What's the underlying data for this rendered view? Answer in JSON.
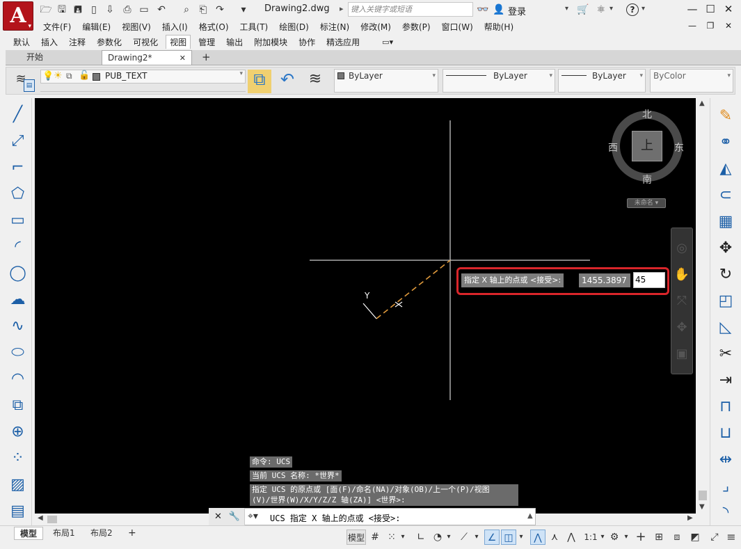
{
  "app": {
    "logo_letter": "A",
    "document_title": "Drawing2.dwg",
    "search_placeholder": "键入关键字或短语",
    "login_label": "登录",
    "help_icon": "?"
  },
  "window_controls": {
    "minimize": "—",
    "maximize": "☐",
    "close": "✕"
  },
  "mdi_controls": {
    "minimize": "—",
    "restore": "❐",
    "close": "✕"
  },
  "menu": [
    "文件(F)",
    "编辑(E)",
    "视图(V)",
    "插入(I)",
    "格式(O)",
    "工具(T)",
    "绘图(D)",
    "标注(N)",
    "修改(M)",
    "参数(P)",
    "窗口(W)",
    "帮助(H)"
  ],
  "ribbon_tabs": {
    "items": [
      "默认",
      "插入",
      "注释",
      "参数化",
      "可视化",
      "视图",
      "管理",
      "输出",
      "附加模块",
      "协作",
      "精选应用"
    ],
    "active": "视图"
  },
  "file_tabs": {
    "start_label": "开始",
    "active_label": "Drawing2*",
    "close_icon": "✕",
    "add_icon": "+"
  },
  "properties_toolbar": {
    "layer_name": "PUB_TEXT",
    "color_combo": "ByLayer",
    "linetype_combo": "ByLayer",
    "lineweight_combo": "ByLayer",
    "plotstyle_combo": "ByColor"
  },
  "viewcube": {
    "north": "北",
    "south": "南",
    "west": "西",
    "east": "东",
    "face": "上",
    "ucs_badge": "未命名 ▾"
  },
  "ucs_icon": {
    "y_label": "Y"
  },
  "dynamic_input": {
    "prompt": "指定 X 轴上的点或 <接受>:",
    "value1": "1455.3897",
    "value2": "45"
  },
  "command_history": [
    "命令: UCS",
    "当前 UCS 名称: *世界*",
    "指定 UCS 的原点或 [面(F)/命名(NA)/对象(OB)/上一个(P)/视图",
    "(V)/世界(W)/X/Y/Z/Z 轴(ZA)] <世界>:"
  ],
  "command_line": {
    "text": "UCS 指定 X 轴上的点或 <接受>:"
  },
  "status_bar": {
    "layout_tabs": [
      "模型",
      "布局1",
      "布局2"
    ],
    "active_layout": "模型",
    "model_label": "模型",
    "scale_label": "1:1"
  },
  "colors": {
    "canvas": "#000000",
    "crosshair": "#ffffff",
    "ucs_line": "#e09a3c",
    "highlight_frame": "#d9252a",
    "logo": "#b3141b"
  }
}
